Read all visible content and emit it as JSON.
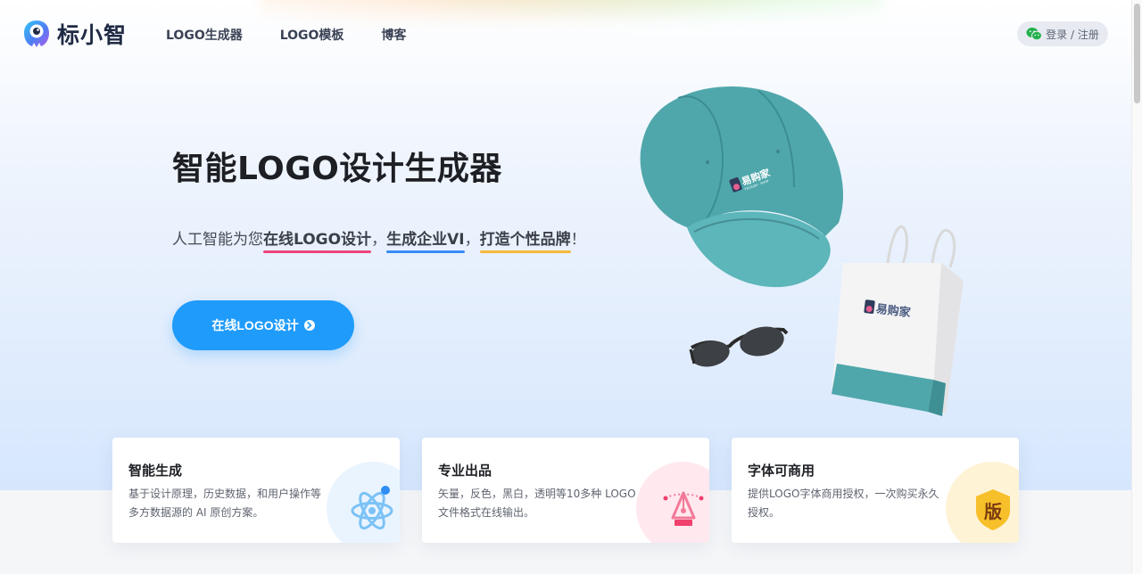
{
  "brand": {
    "name": "标小智"
  },
  "nav": {
    "items": [
      "LOGO生成器",
      "LOGO模板",
      "博客"
    ]
  },
  "auth": {
    "label": "登录 / 注册"
  },
  "hero": {
    "title": "智能LOGO设计生成器",
    "subtitle": {
      "p1": "人工智能为您",
      "h1": "在线LOGO设计",
      "p2": "，",
      "h2": "生成企业VI",
      "p3": "，",
      "h3": "打造个性品牌",
      "p4": "！"
    },
    "cta_label": "在线LOGO设计"
  },
  "illustration": {
    "brand_mark": "易购家",
    "brand_tagline": "YIGOUJIA · SHOP"
  },
  "features": [
    {
      "title": "智能生成",
      "desc": "基于设计原理，历史数据，和用户操作等多方数据源的 AI 原创方案。",
      "icon": "atom-icon"
    },
    {
      "title": "专业出品",
      "desc": "矢量，反色，黑白，透明等10多种 LOGO 文件格式在线输出。",
      "icon": "pen-tool-icon"
    },
    {
      "title": "字体可商用",
      "desc": "提供LOGO字体商用授权，一次购买永久授权。",
      "icon": "copyright-shield-icon",
      "badge": "版"
    }
  ],
  "colors": {
    "accent": "#1f9bfc",
    "underline_red": "#f0447a",
    "underline_blue": "#3a8cf6",
    "underline_yellow": "#f6b93a"
  }
}
